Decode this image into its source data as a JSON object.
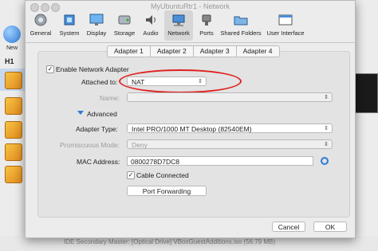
{
  "window": {
    "title": "MyUbuntuRtr1 - Network"
  },
  "background": {
    "new_label": "New",
    "group_label": "H1",
    "status_text": "IDE Secondary Master:  [Optical Drive] VBoxGuestAdditions.iso (56.79 MB)"
  },
  "toolbar": {
    "items": [
      {
        "label": "General",
        "icon": "general-icon"
      },
      {
        "label": "System",
        "icon": "system-chip-icon"
      },
      {
        "label": "Display",
        "icon": "display-monitor-icon"
      },
      {
        "label": "Storage",
        "icon": "storage-disk-icon"
      },
      {
        "label": "Audio",
        "icon": "audio-speaker-icon"
      },
      {
        "label": "Network",
        "icon": "network-globe-icon"
      },
      {
        "label": "Ports",
        "icon": "ports-connector-icon"
      },
      {
        "label": "Shared Folders",
        "icon": "shared-folder-icon"
      },
      {
        "label": "User Interface",
        "icon": "user-interface-window-icon"
      }
    ],
    "active": "Network"
  },
  "tabs": [
    "Adapter 1",
    "Adapter 2",
    "Adapter 3",
    "Adapter 4"
  ],
  "form": {
    "enable_label": "Enable Network Adapter",
    "enable_checked": "✓",
    "attached_label": "Attached to:",
    "attached_value": "NAT",
    "name_label": "Name:",
    "name_value": "",
    "advanced_label": "Advanced",
    "adapter_type_label": "Adapter Type:",
    "adapter_type_value": "Intel PRO/1000 MT Desktop (82540EM)",
    "promiscuous_label": "Promiscuous Mode:",
    "promiscuous_value": "Deny",
    "mac_label": "MAC Address:",
    "mac_value": "0800278D7DC8",
    "cable_label": "Cable Connected",
    "cable_checked": "✓",
    "port_forwarding_label": "Port Forwarding"
  },
  "buttons": {
    "cancel": "Cancel",
    "ok": "OK"
  },
  "colors": {
    "highlight_oval": "#e02020",
    "accent": "#2f7ad6"
  }
}
